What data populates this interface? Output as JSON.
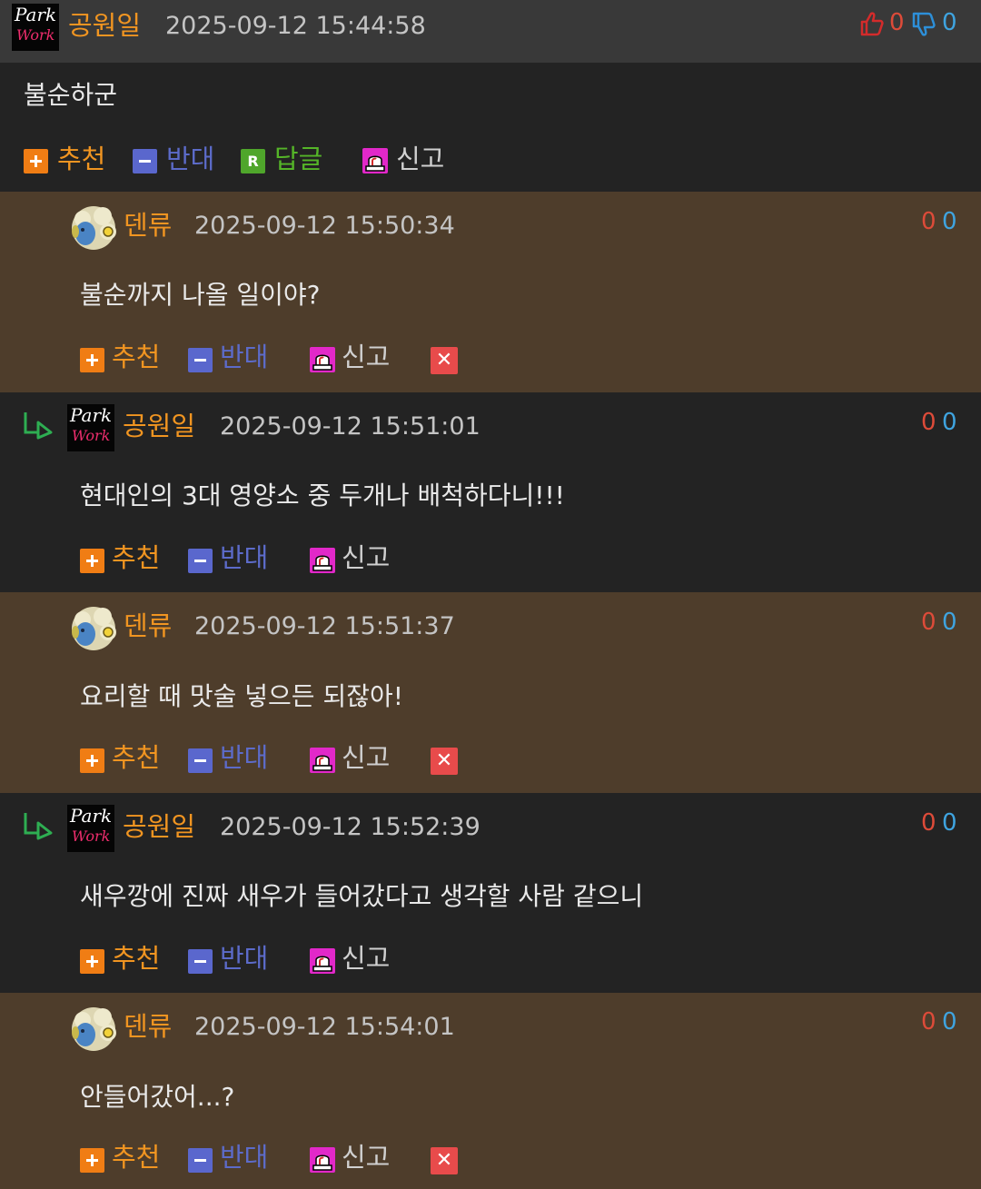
{
  "main_comment": {
    "author": "공원일",
    "timestamp": "2025-09-12 15:44:58",
    "likes": "0",
    "dislikes": "0",
    "text": "불순하군",
    "actions": {
      "recommend": "추천",
      "oppose": "반대",
      "reply": "답글",
      "report": "신고"
    }
  },
  "replies": [
    {
      "author": "덴류",
      "timestamp": "2025-09-12 15:50:34",
      "likes": "0",
      "dislikes": "0",
      "text": "불순까지 나올 일이야?",
      "recommend": "추천",
      "oppose": "반대",
      "report": "신고"
    },
    {
      "author": "공원일",
      "timestamp": "2025-09-12 15:51:01",
      "likes": "0",
      "dislikes": "0",
      "text": "현대인의 3대 영양소 중 두개나 배척하다니!!!",
      "recommend": "추천",
      "oppose": "반대",
      "report": "신고"
    },
    {
      "author": "덴류",
      "timestamp": "2025-09-12 15:51:37",
      "likes": "0",
      "dislikes": "0",
      "text": "요리할 때 맛술 넣으든 되잖아!",
      "recommend": "추천",
      "oppose": "반대",
      "report": "신고"
    },
    {
      "author": "공원일",
      "timestamp": "2025-09-12 15:52:39",
      "likes": "0",
      "dislikes": "0",
      "text": "새우깡에 진짜 새우가 들어갔다고 생각할 사람 같으니",
      "recommend": "추천",
      "oppose": "반대",
      "report": "신고"
    },
    {
      "author": "덴류",
      "timestamp": "2025-09-12 15:54:01",
      "likes": "0",
      "dislikes": "0",
      "text": "안들어갔어...?",
      "recommend": "추천",
      "oppose": "반대",
      "report": "신고"
    }
  ],
  "avatar_text": {
    "park": "Park",
    "work": "Work"
  },
  "icons": {
    "thumbs_up": "thumbs-up-icon",
    "thumbs_down": "thumbs-down-icon",
    "plus": "plus-icon",
    "minus": "minus-icon",
    "reply": "reply-icon",
    "report": "siren-icon",
    "delete": "close-icon",
    "reply_arrow": "reply-arrow-icon"
  },
  "colors": {
    "header_bg": "#393939",
    "dark_bg": "#232323",
    "brown_bg": "#4e3d2b",
    "nick": "#f19521",
    "like": "#dd4b39",
    "dislike": "#3fa4e0",
    "recommend": "#f19521",
    "oppose": "#5c6bc9",
    "reply": "#55b528"
  }
}
